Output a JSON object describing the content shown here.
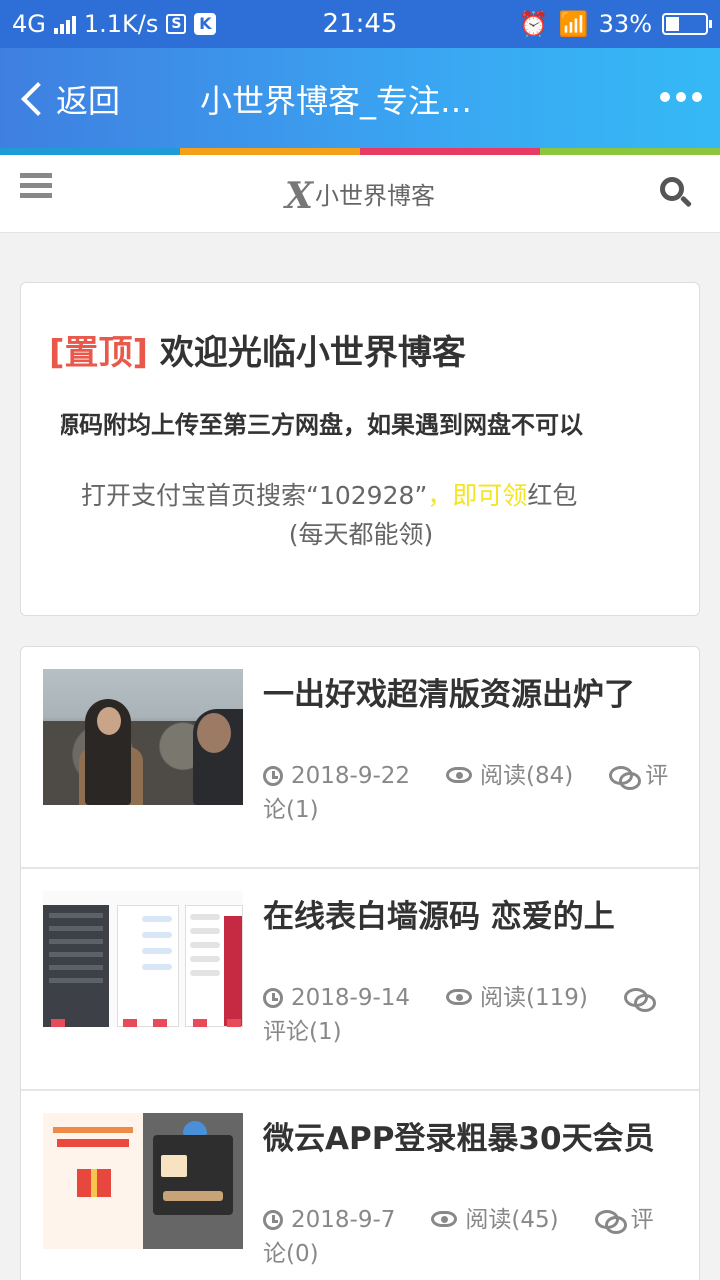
{
  "status_bar": {
    "network": "4G",
    "speed": "1.1K/s",
    "sim_icon": "S",
    "app_icon": "K",
    "time": "21:45",
    "battery": "33%",
    "battery_level": 0.33
  },
  "app_bar": {
    "back_label": "返回",
    "title": "小世界博客_专注…",
    "more_icon": "more-dots-icon"
  },
  "accent_colors": [
    "#1f9bd8",
    "#f3a01a",
    "#e83b64",
    "#8cc63e"
  ],
  "site_header": {
    "logo_mark": "X",
    "logo_text": "小世界博客"
  },
  "pinned": {
    "tag": "[置顶]",
    "title": "欢迎光临小世界博客",
    "line": "源码附均上传至第三方网盘，如果遇到网盘不可以",
    "promo_text_1": "打开支付宝首页搜索“102928”",
    "promo_sep": "，",
    "promo_highlight": "即可领",
    "promo_text_2": "红包",
    "promo_sub": "(每天都能领)"
  },
  "posts": [
    {
      "title": "一出好戏超清版资源出炉了",
      "date": "2018-9-22",
      "views": "阅读(84)",
      "comments_a": "评",
      "comments_b": "论(1)"
    },
    {
      "title": "在线表白墙源码 恋爱的上",
      "date": "2018-9-14",
      "views": "阅读(119)",
      "comments_a": "",
      "comments_b": "评论(1)"
    },
    {
      "title": "微云APP登录粗暴30天会员",
      "date": "2018-9-7",
      "views": "阅读(45)",
      "comments_a": "评",
      "comments_b": "论(0)"
    }
  ]
}
